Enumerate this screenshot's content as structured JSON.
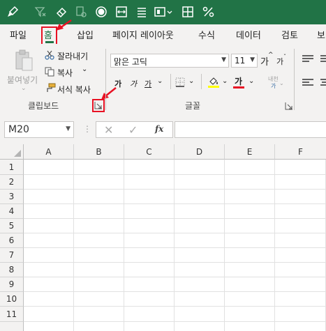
{
  "quick_access": {
    "icons": [
      "paintbrush-icon",
      "filter-clear-icon",
      "eraser-icon",
      "format-painter-icon",
      "circle-icon",
      "center-across-icon",
      "align-justify-icon",
      "media-icon",
      "grid-icon",
      "percent-icon"
    ]
  },
  "tabs": [
    {
      "label": "파일"
    },
    {
      "label": "홈"
    },
    {
      "label": "삽입"
    },
    {
      "label": "페이지 레이아웃"
    },
    {
      "label": "수식"
    },
    {
      "label": "데이터"
    },
    {
      "label": "검토"
    },
    {
      "label": "보"
    }
  ],
  "clipboard": {
    "paste_label": "붙여넣기",
    "cut_label": "잘라내기",
    "copy_label": "복사",
    "format_painter_label": "서식 복사",
    "group_label": "클립보드"
  },
  "font": {
    "font_name": "맑은 고딕",
    "font_size": "11",
    "grow_label": "가",
    "shrink_label": "가",
    "bold_label": "가",
    "italic_label": "가",
    "underline_label": "가",
    "font_color_label": "가",
    "phonetic_label": "내천",
    "group_label": "글꼴"
  },
  "formula_bar": {
    "name_box": "M20",
    "fx_label": "fx",
    "formula": ""
  },
  "sheet": {
    "columns": [
      "A",
      "B",
      "C",
      "D",
      "E",
      "F"
    ],
    "rows": [
      "1",
      "2",
      "3",
      "4",
      "5",
      "6",
      "7",
      "8",
      "9",
      "10",
      "11"
    ]
  },
  "colors": {
    "excel_green": "#217346",
    "highlight_red": "#e81123",
    "fill_yellow": "#ffff00",
    "font_red": "#e81123"
  }
}
